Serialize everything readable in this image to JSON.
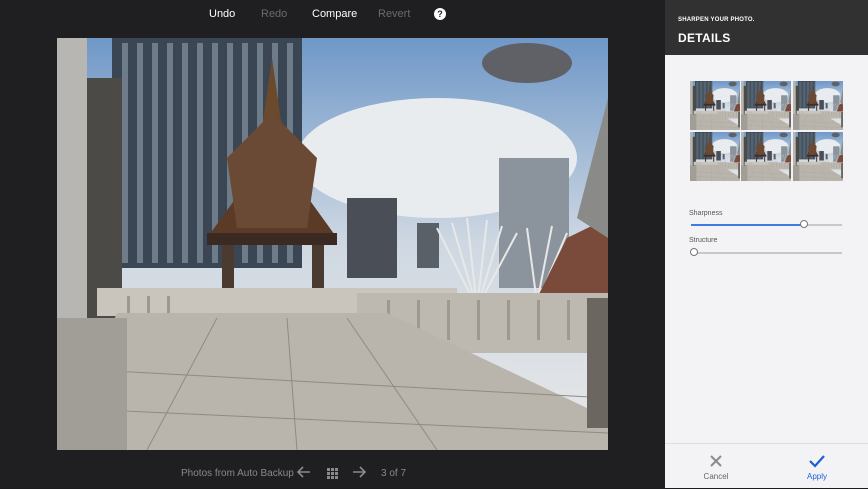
{
  "toolbar": {
    "undo": "Undo",
    "redo": "Redo",
    "compare": "Compare",
    "revert": "Revert",
    "help": "?"
  },
  "footer": {
    "album": "Photos from Auto Backup",
    "counter": "3 of 7"
  },
  "panel": {
    "subtitle": "SHARPEN YOUR PHOTO.",
    "title": "DETAILS",
    "sliders": [
      {
        "label": "Sharpness",
        "value": 0.75
      },
      {
        "label": "Structure",
        "value": 0.0
      }
    ],
    "cancel": "Cancel",
    "apply": "Apply"
  },
  "colors": {
    "accent": "#3f7ae0",
    "apply_text": "#1c5fd6",
    "panel_header": "#323132"
  },
  "icons": {
    "back": "arrow-left-icon",
    "grid": "grid-icon",
    "forward": "arrow-right-icon",
    "cancel": "close-icon",
    "apply": "check-icon"
  }
}
